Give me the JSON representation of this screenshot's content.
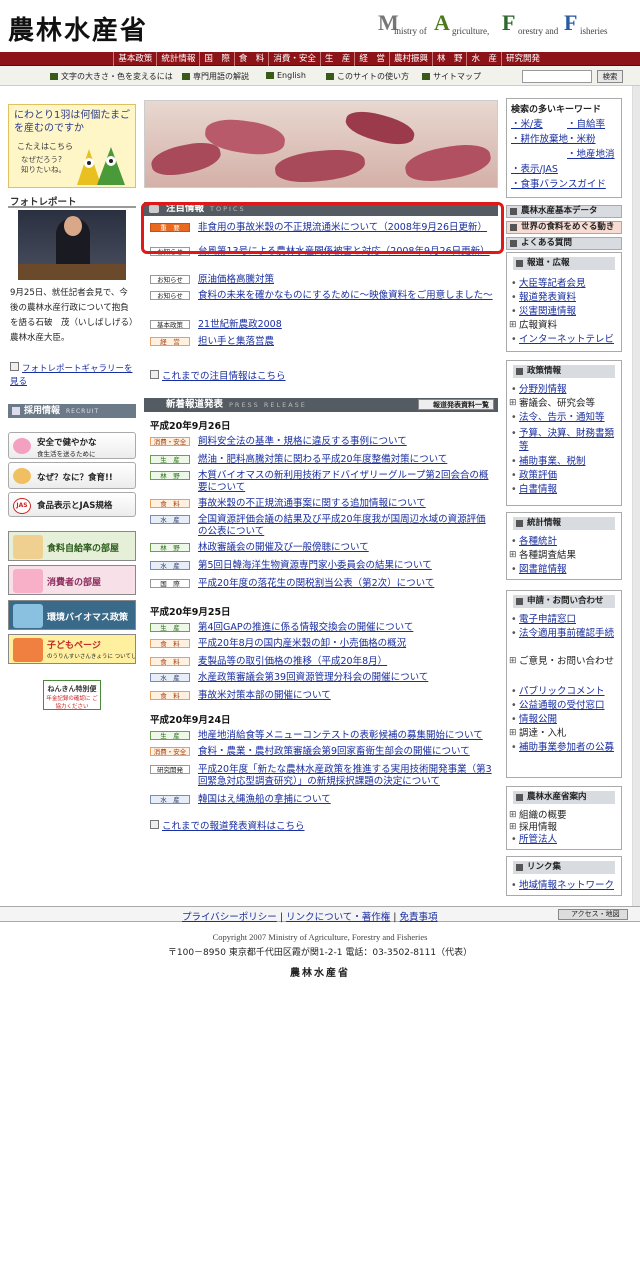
{
  "header": {
    "logo": "農林水産省",
    "english": {
      "m": "M",
      "inistry_of": "inistry of",
      "a": "A",
      "griculture": "griculture,",
      "f": "F",
      "orestry_and": "orestry and",
      "fi": "F",
      "isheries": "isheries"
    }
  },
  "nav": [
    "基本政策",
    "統計情報",
    "国　際",
    "食　料",
    "消費・安全",
    "生　産",
    "経　営",
    "農村振興",
    "林　野",
    "水　産",
    "研究開発"
  ],
  "subnav": {
    "font_size": "文字の大きさ・色を変えるには",
    "glossary": "専門用語の解説",
    "english": "English",
    "how_to": "このサイトの使い方",
    "sitemap": "サイトマップ",
    "search_button": "検索",
    "search_value": ""
  },
  "left": {
    "question": {
      "title": "にわとり1羽は何個たまご\nを産むのですか",
      "answer": "こたえはこちら",
      "bubble": "なぜだろう?\n知りたいね。"
    },
    "photo": {
      "heading": "フォトレポート",
      "caption": "9月25日、就任記者会見で、今後の農林水産行政について抱負を語る石破　茂（いしばしげる）農林水産大臣。",
      "more": "フォトレポートギャラリーを見る"
    },
    "recruit": {
      "title": "採用情報",
      "sub": "RECRUIT"
    },
    "banners": [
      {
        "main": "安全で健やかな",
        "sub": "食生活を送るために"
      },
      {
        "main": "なぜ？なに？食育!!"
      },
      {
        "main": "食品表示とJAS規格",
        "icon": "JAS"
      },
      {
        "main": "食料自給率の部屋"
      },
      {
        "main": "消費者の部屋"
      },
      {
        "main": "環境バイオマス政策"
      },
      {
        "main": "子どもページ",
        "sub": "のうりんすいさんきょうに ついてしょうかいしています。"
      },
      {
        "main": "ねんきん特別便",
        "sub": "年金記録の確認に ご協力ください"
      }
    ]
  },
  "topics": {
    "title": "注目情報",
    "sub": "TOPICS",
    "items": [
      {
        "tag": "重　要",
        "text": "非食用の事故米穀の不正規流通米について（2008年9月26日更新）"
      },
      {
        "tag": "お知らせ",
        "text": "台風第13号による農林水産関係被害と対応（2008年9月26日更新）"
      },
      {
        "tag": "お知らせ",
        "text": "原油価格高騰対策"
      },
      {
        "tag": "お知らせ",
        "text": "食料の未来を確かなものにするために～映像資料をご用意しました～"
      },
      {
        "tag": "基本政策",
        "text": "21世紀新農政2008"
      },
      {
        "tag": "経　営",
        "text": "担い手と集落営農"
      }
    ],
    "more": "これまでの注目情報はこちら"
  },
  "press": {
    "title": "新着報道発表",
    "sub": "PRESS RELEASE",
    "list_button": "報道発表資料一覧",
    "groups": [
      {
        "date": "平成20年9月26日",
        "items": [
          {
            "tag": "消費・安全",
            "text": "飼料安全法の基準・規格に違反する事例について"
          },
          {
            "tag": "生　産",
            "text": "燃油・肥料高騰対策に関わる平成20年度整備対策について"
          },
          {
            "tag": "林　野",
            "text": "木質バイオマスの新利用技術アドバイザリーグループ第2回会合の概要について"
          },
          {
            "tag": "食　料",
            "text": "事故米穀の不正規流通事案に関する追加情報について"
          },
          {
            "tag": "水　産",
            "text": "全国資源評価会議の結果及び平成20年度我が国周辺水域の資源評価の公表について"
          },
          {
            "tag": "林　野",
            "text": "林政審議会の開催及び一般傍聴について"
          },
          {
            "tag": "水　産",
            "text": "第5回日韓海洋生物資源専門家小委員会の結果について"
          },
          {
            "tag": "国　際",
            "text": "平成20年度の落花生の関税割当公表（第2次）について"
          }
        ]
      },
      {
        "date": "平成20年9月25日",
        "items": [
          {
            "tag": "生　産",
            "text": "第4回GAPの推進に係る情報交換会の開催について"
          },
          {
            "tag": "食　料",
            "text": "平成20年8月の国内産米穀の卸・小売価格の概況"
          },
          {
            "tag": "食　料",
            "text": "麦製品等の取引価格の推移（平成20年8月）"
          },
          {
            "tag": "水　産",
            "text": "水産政策審議会第39回資源管理分科会の開催について"
          },
          {
            "tag": "食　料",
            "text": "事故米対策本部の開催について"
          }
        ]
      },
      {
        "date": "平成20年9月24日",
        "items": [
          {
            "tag": "生　産",
            "text": "地産地消給食等メニューコンテストの表彰候補の募集開始について"
          },
          {
            "tag": "消費・安全",
            "text": "食料・農業・農村政策審議会第9回家畜衛生部会の開催について"
          },
          {
            "tag": "研究開発",
            "text": "平成20年度「新たな農林水産政策を推進する実用技術開発事業（第3回緊急対応型調査研究）」の新規採択課題の決定について"
          },
          {
            "tag": "水　産",
            "text": "韓国はえ縄漁船の拿捕について"
          }
        ]
      }
    ],
    "more": "これまでの報道発表資料はこちら"
  },
  "right": {
    "keywords": {
      "title": "検索の多いキーワード",
      "items": [
        "米/麦",
        "自給率",
        "耕作放棄地",
        "米粉",
        "地産地消",
        "表示/JAS",
        "食事バランスガイド"
      ]
    },
    "basic_data": "農林水産基本データ",
    "world_food": "世界の食料をめぐる動き",
    "faq": "よくある質問",
    "press_box": {
      "title": "報道・広報",
      "items": [
        "大臣等記者会見",
        "報道発表資料",
        "災害関連情報",
        "広報資料",
        "インターネットテレビ"
      ]
    },
    "policy_box": {
      "title": "政策情報",
      "items": [
        "分野別情報",
        "審議会、研究会等",
        "法令、告示・通知等",
        "予算、決算、財務書類等",
        "補助事業、税制",
        "政策評価",
        "白書情報"
      ]
    },
    "stats_box": {
      "title": "統計情報",
      "items": [
        "各種統計",
        "各種調査結果",
        "図書館情報"
      ]
    },
    "apply_box": {
      "title": "申請・お問い合わせ",
      "items": [
        "電子申請窓口",
        "法令適用事前確認手続",
        "ご意見・お問い合わせ",
        "パブリックコメント",
        "公益通報の受付窓口",
        "情報公開",
        "調達・入札",
        "補助事業参加者の公募"
      ]
    },
    "org_box": {
      "title": "農林水産省案内",
      "items": [
        "組織の概要",
        "採用情報",
        "所管法人"
      ]
    },
    "links_box": {
      "title": "リンク集",
      "items": [
        "地域情報ネットワーク"
      ]
    }
  },
  "footer": {
    "privacy": "プライバシーポリシー",
    "links": "リンクについて・著作権",
    "disclaimer": "免責事項",
    "access": "アクセス・地図",
    "copyright": "Copyright 2007 Ministry of Agriculture, Forestry and Fisheries",
    "address": "〒100－8950 東京都千代田区霞が関1-2-1 電話：03-3502-8111（代表）",
    "name": "農林水産省"
  }
}
